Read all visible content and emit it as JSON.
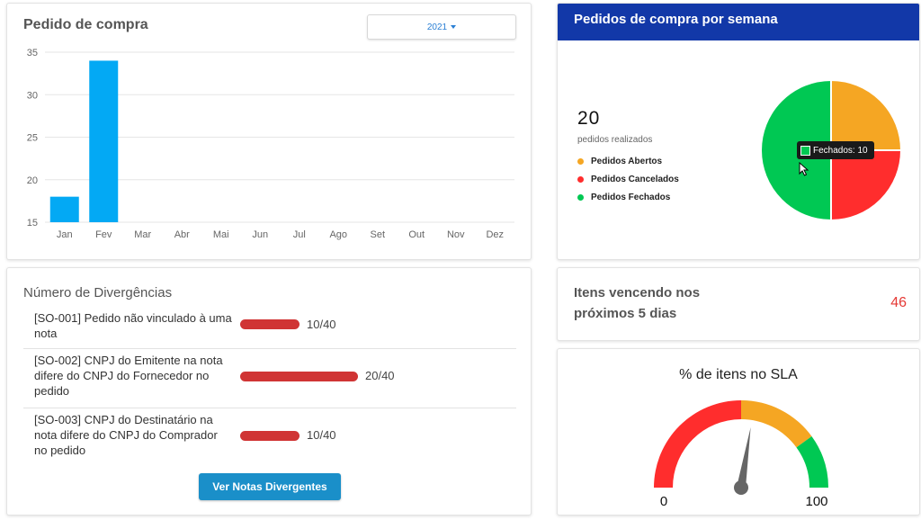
{
  "pedido_compra": {
    "title": "Pedido de compra",
    "year": "2021"
  },
  "chart_data": {
    "type": "bar",
    "categories": [
      "Jan",
      "Fev",
      "Mar",
      "Abr",
      "Mai",
      "Jun",
      "Jul",
      "Ago",
      "Set",
      "Out",
      "Nov",
      "Dez"
    ],
    "values": [
      18,
      34,
      null,
      null,
      null,
      null,
      null,
      null,
      null,
      null,
      null,
      null
    ],
    "ylim": [
      15,
      35
    ],
    "yticks": [
      15,
      20,
      25,
      30,
      35
    ],
    "grid": true,
    "color": "#03a9f4"
  },
  "semana": {
    "title": "Pedidos de compra por semana",
    "total": "20",
    "total_label": "pedidos realizados",
    "legend": [
      {
        "label": "Pedidos Abertos",
        "color": "#f5a623"
      },
      {
        "label": "Pedidos Cancelados",
        "color": "#ff2d2d"
      },
      {
        "label": "Pedidos Fechados",
        "color": "#00c853"
      }
    ],
    "pie": [
      {
        "name": "Pedidos Abertos",
        "value": 5,
        "color": "#f5a623"
      },
      {
        "name": "Pedidos Cancelados",
        "value": 5,
        "color": "#ff2d2d"
      },
      {
        "name": "Pedidos Fechados",
        "value": 10,
        "color": "#00c853"
      }
    ],
    "tooltip": "Fechados: 10"
  },
  "divergencias": {
    "title": "Número de Divergências",
    "rows": [
      {
        "text": "[SO-001] Pedido não vinculado à uma nota",
        "label": "10/40",
        "fraction": 0.25
      },
      {
        "text": "[SO-002] CNPJ do Emitente na nota difere do CNPJ do Fornecedor no pedido",
        "label": "20/40",
        "fraction": 0.5
      },
      {
        "text": "[SO-003] CNPJ do Destinatário na nota difere do CNPJ do Comprador no pedido",
        "label": "10/40",
        "fraction": 0.25
      }
    ],
    "button_label": "Ver Notas Divergentes"
  },
  "itens": {
    "label": "Itens vencendo nos próximos 5 dias",
    "value": "46"
  },
  "sla": {
    "title": "% de itens no SLA",
    "min": "0",
    "max": "100",
    "value_percent": 55,
    "colors": {
      "low": "#ff2d2d",
      "mid": "#f5a623",
      "high": "#00c853"
    }
  }
}
